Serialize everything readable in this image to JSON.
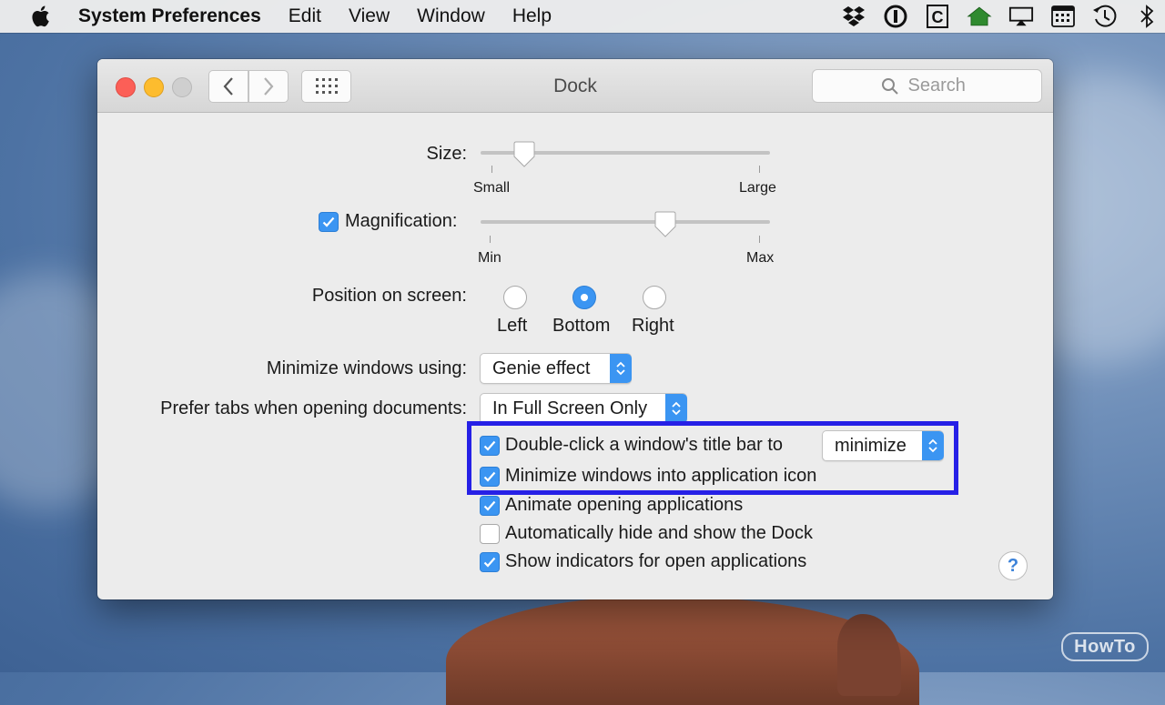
{
  "menubar": {
    "app_name": "System Preferences",
    "items": [
      "Edit",
      "View",
      "Window",
      "Help"
    ],
    "status_icons": [
      "dropbox-icon",
      "1password-icon",
      "clipboard-c-icon",
      "home-icon",
      "airplay-icon",
      "calendar-grid-icon",
      "time-machine-icon",
      "bluetooth-icon"
    ]
  },
  "window": {
    "title": "Dock",
    "search_placeholder": "Search"
  },
  "dock": {
    "size_label": "Size:",
    "size_min": "Small",
    "size_max": "Large",
    "size_value": 0.12,
    "magnification_label": "Magnification:",
    "magnification_enabled": true,
    "magnification_min": "Min",
    "magnification_max": "Max",
    "magnification_value": 0.65,
    "position_label": "Position on screen:",
    "positions": [
      "Left",
      "Bottom",
      "Right"
    ],
    "position_selected": "Bottom",
    "minimize_label": "Minimize windows using:",
    "minimize_value": "Genie effect",
    "tabs_label": "Prefer tabs when opening documents:",
    "tabs_value": "In Full Screen Only",
    "double_click_label": "Double-click a window's title bar to",
    "double_click_value": "minimize",
    "options": [
      {
        "label": "Minimize windows into application icon",
        "checked": true
      },
      {
        "label": "Animate opening applications",
        "checked": true
      },
      {
        "label": "Automatically hide and show the Dock",
        "checked": false
      },
      {
        "label": "Show indicators for open applications",
        "checked": true
      }
    ],
    "double_click_checked": true,
    "help": "?"
  },
  "watermark": "HowTo",
  "colors": {
    "accent": "#3b95f2",
    "highlight": "#2620e6"
  }
}
